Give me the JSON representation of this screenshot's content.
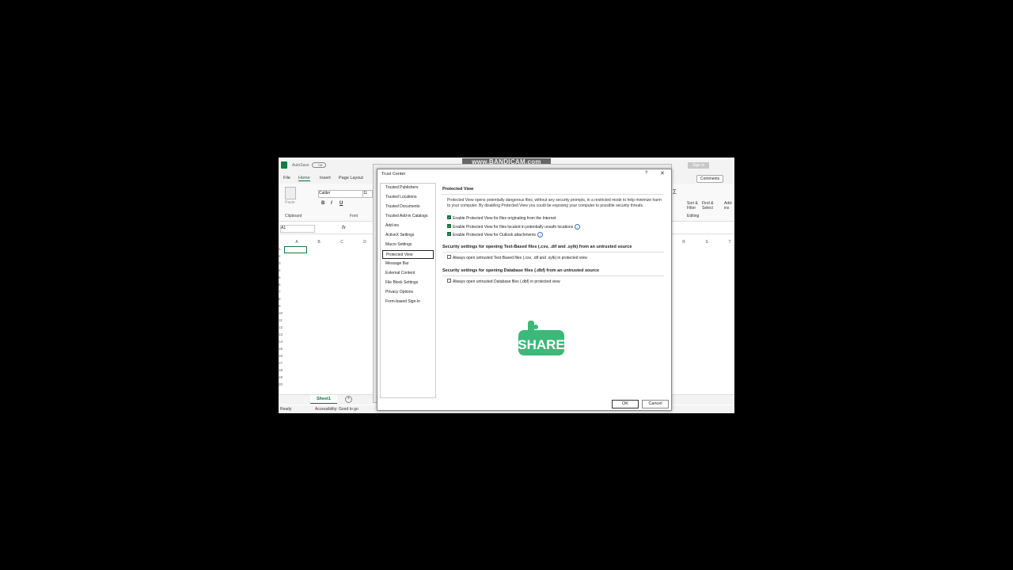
{
  "banner": "www.BANDICAM.com",
  "excel": {
    "autosave": "AutoSave",
    "toggle": "Off",
    "signin": "Sign in",
    "tabs": [
      "File",
      "Home",
      "Insert",
      "Page Layout"
    ],
    "comments": "Comments",
    "font_name": "Calibri",
    "font_size": "11",
    "clipboard_label": "Clipboard",
    "font_label": "Font",
    "paste_label": "Paste",
    "editing_label": "Editing",
    "sort_filter": "Sort &",
    "sort_filter2": "Filter",
    "find_select": "Find &",
    "find_select2": "Select",
    "addins": "Add-ins",
    "name_box": "A1",
    "fx": "fx",
    "columns": [
      "A",
      "B",
      "C",
      "D"
    ],
    "columns_right": [
      "R",
      "S",
      "T"
    ],
    "rows": [
      "1",
      "2",
      "3",
      "4",
      "5",
      "6",
      "7",
      "8",
      "9",
      "10",
      "11",
      "12",
      "13",
      "14",
      "15",
      "16",
      "17",
      "18",
      "19",
      "20"
    ],
    "sheet_tab": "Sheet1",
    "status_ready": "Ready",
    "status_accessibility": "Accessibility: Good to go"
  },
  "dialog": {
    "title": "Trust Center",
    "help": "?",
    "close": "✕",
    "nav": [
      "Trusted Publishers",
      "Trusted Locations",
      "Trusted Documents",
      "Trusted Add-in Catalogs",
      "Add-ins",
      "ActiveX Settings",
      "Macro Settings",
      "Protected View",
      "Message Bar",
      "External Content",
      "File Block Settings",
      "Privacy Options",
      "Form-based Sign-in"
    ],
    "selected_nav": "Protected View",
    "section1_title": "Protected View",
    "description": "Protected View opens potentially dangerous files, without any security prompts, in a restricted mode to help minimize harm to your computer. By disabling Protected View you could be exposing your computer to possible security threats.",
    "checks": [
      {
        "label": "Enable Protected View for files originating from the Internet",
        "checked": true,
        "info": false
      },
      {
        "label": "Enable Protected View for files located in potentially unsafe locations",
        "checked": true,
        "info": true
      },
      {
        "label": "Enable Protected View for Outlook attachments",
        "checked": true,
        "info": true
      }
    ],
    "section2_title": "Security settings for opening Text-Based files (.csv, .dif and .sylk) from an untrusted source",
    "section2_check": "Always open untrusted Text-Based files (.csv, .dif and .sylk) in protected view",
    "section3_title": "Security settings for opening Database files (.dbf) from an untrusted source",
    "section3_check": "Always open untrusted Database files (.dbf) in protected view",
    "share_text": "SHARE",
    "ok": "OK",
    "cancel": "Cancel"
  },
  "colors": {
    "accent": "#107c41",
    "share_green": "#3cb878"
  }
}
